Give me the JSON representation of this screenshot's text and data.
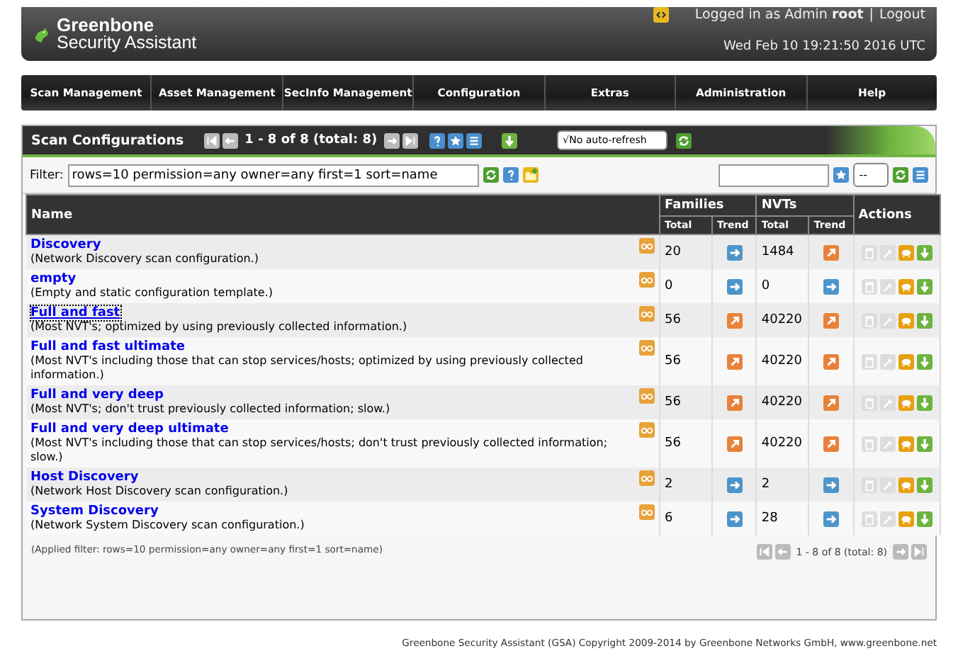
{
  "header": {
    "brand_line1": "Greenbone",
    "brand_line2": "Security Assistant",
    "logged_in_prefix": "Logged in as Admin",
    "user": "root",
    "separator": "|",
    "logout": "Logout",
    "datetime": "Wed Feb 10 19:21:50 2016 UTC"
  },
  "nav": [
    "Scan Management",
    "Asset Management",
    "SecInfo Management",
    "Configuration",
    "Extras",
    "Administration",
    "Help"
  ],
  "panel": {
    "title": "Scan Configurations",
    "pager": "1 - 8 of 8 (total: 8)",
    "refresh": "√No auto-refresh"
  },
  "filter": {
    "label": "Filter:",
    "value": "rows=10 permission=any owner=any first=1 sort=name",
    "rows_select": "--"
  },
  "table": {
    "name_header": "Name",
    "families_header": "Families",
    "nvts_header": "NVTs",
    "actions_header": "Actions",
    "sub_headers": [
      "Total",
      "Trend",
      "Total",
      "Trend"
    ],
    "rows": [
      {
        "name": "Discovery",
        "comment": "(Network Discovery scan configuration.)",
        "focused": false,
        "families": "20",
        "families_rising": false,
        "nvts": "1484",
        "nvts_rising": true
      },
      {
        "name": "empty",
        "comment": "(Empty and static configuration template.)",
        "focused": false,
        "families": "0",
        "families_rising": false,
        "nvts": "0",
        "nvts_rising": false
      },
      {
        "name": "Full and fast",
        "comment": "(Most NVT's; optimized by using previously collected information.)",
        "focused": true,
        "families": "56",
        "families_rising": true,
        "nvts": "40220",
        "nvts_rising": true
      },
      {
        "name": "Full and fast ultimate",
        "comment": "(Most NVT's including those that can stop services/hosts; optimized by using previously collected information.)",
        "focused": false,
        "families": "56",
        "families_rising": true,
        "nvts": "40220",
        "nvts_rising": true
      },
      {
        "name": "Full and very deep",
        "comment": "(Most NVT's; don't trust previously collected information; slow.)",
        "focused": false,
        "families": "56",
        "families_rising": true,
        "nvts": "40220",
        "nvts_rising": true
      },
      {
        "name": "Full and very deep ultimate",
        "comment": "(Most NVT's including those that can stop services/hosts; don't trust previously collected information; slow.)",
        "focused": false,
        "families": "56",
        "families_rising": true,
        "nvts": "40220",
        "nvts_rising": true
      },
      {
        "name": "Host Discovery",
        "comment": "(Network Host Discovery scan configuration.)",
        "focused": false,
        "families": "2",
        "families_rising": false,
        "nvts": "2",
        "nvts_rising": false
      },
      {
        "name": "System Discovery",
        "comment": "(Network System Discovery scan configuration.)",
        "focused": false,
        "families": "6",
        "families_rising": false,
        "nvts": "28",
        "nvts_rising": false
      }
    ]
  },
  "applied_filter": "(Applied filter: rows=10 permission=any owner=any first=1 sort=name)",
  "bottom_pager": "1 - 8 of 8 (total: 8)",
  "footer": "Greenbone Security Assistant (GSA) Copyright 2009-2014 by Greenbone Networks GmbH, www.greenbone.net"
}
